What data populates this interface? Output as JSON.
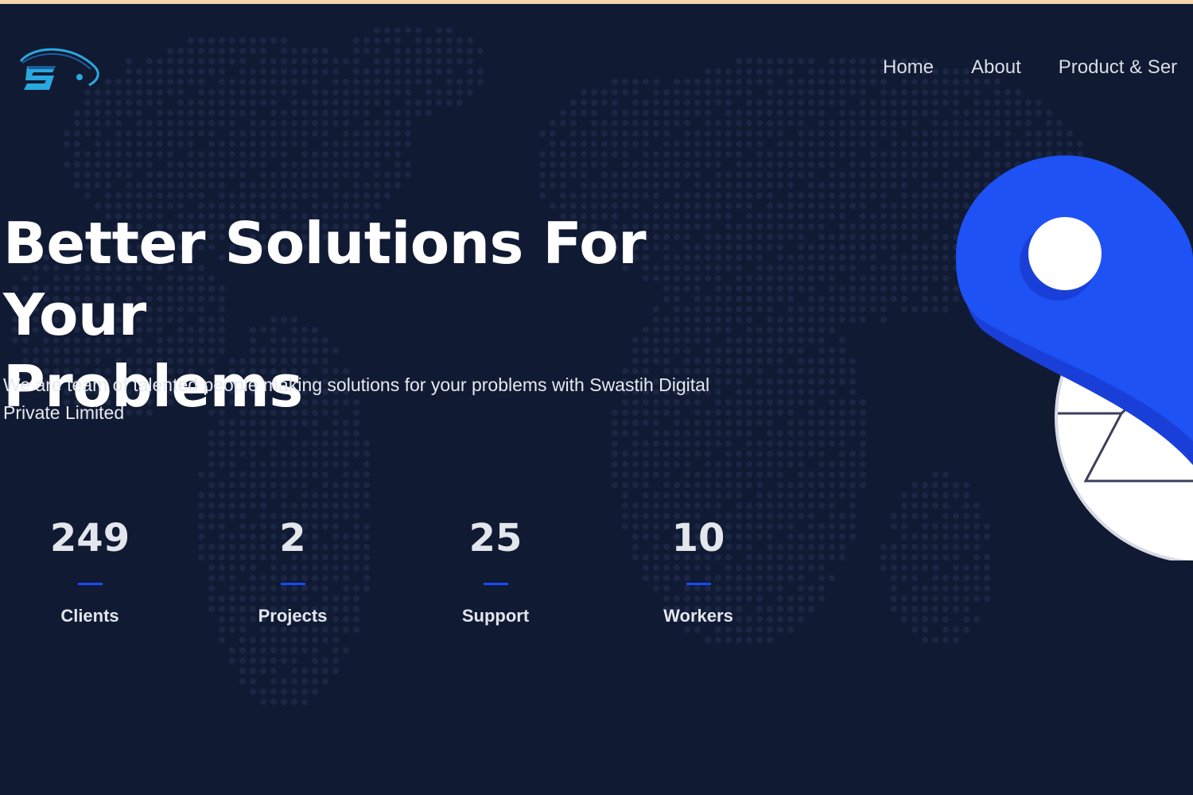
{
  "brand": {
    "logo_icon": "swastih-logo-icon",
    "colors": {
      "background": "#111a33",
      "accent": "#1a49ff",
      "dots": "#243052",
      "top_strip": "#f3d6a9"
    }
  },
  "nav": {
    "items": [
      {
        "label": "Home"
      },
      {
        "label": "About"
      },
      {
        "label": "Product & Ser"
      }
    ]
  },
  "hero": {
    "title_line1": "Better Solutions For Your",
    "title_line2": "Problems",
    "subtitle": "We are team of talented people making solutions for your problems with Swastih Digital Private Limited"
  },
  "stats": [
    {
      "number": "249",
      "label": "Clients"
    },
    {
      "number": "2",
      "label": "Projects"
    },
    {
      "number": "25",
      "label": "Support"
    },
    {
      "number": "10",
      "label": "Workers"
    }
  ],
  "illustration": {
    "icon": "location-pin-icon"
  }
}
